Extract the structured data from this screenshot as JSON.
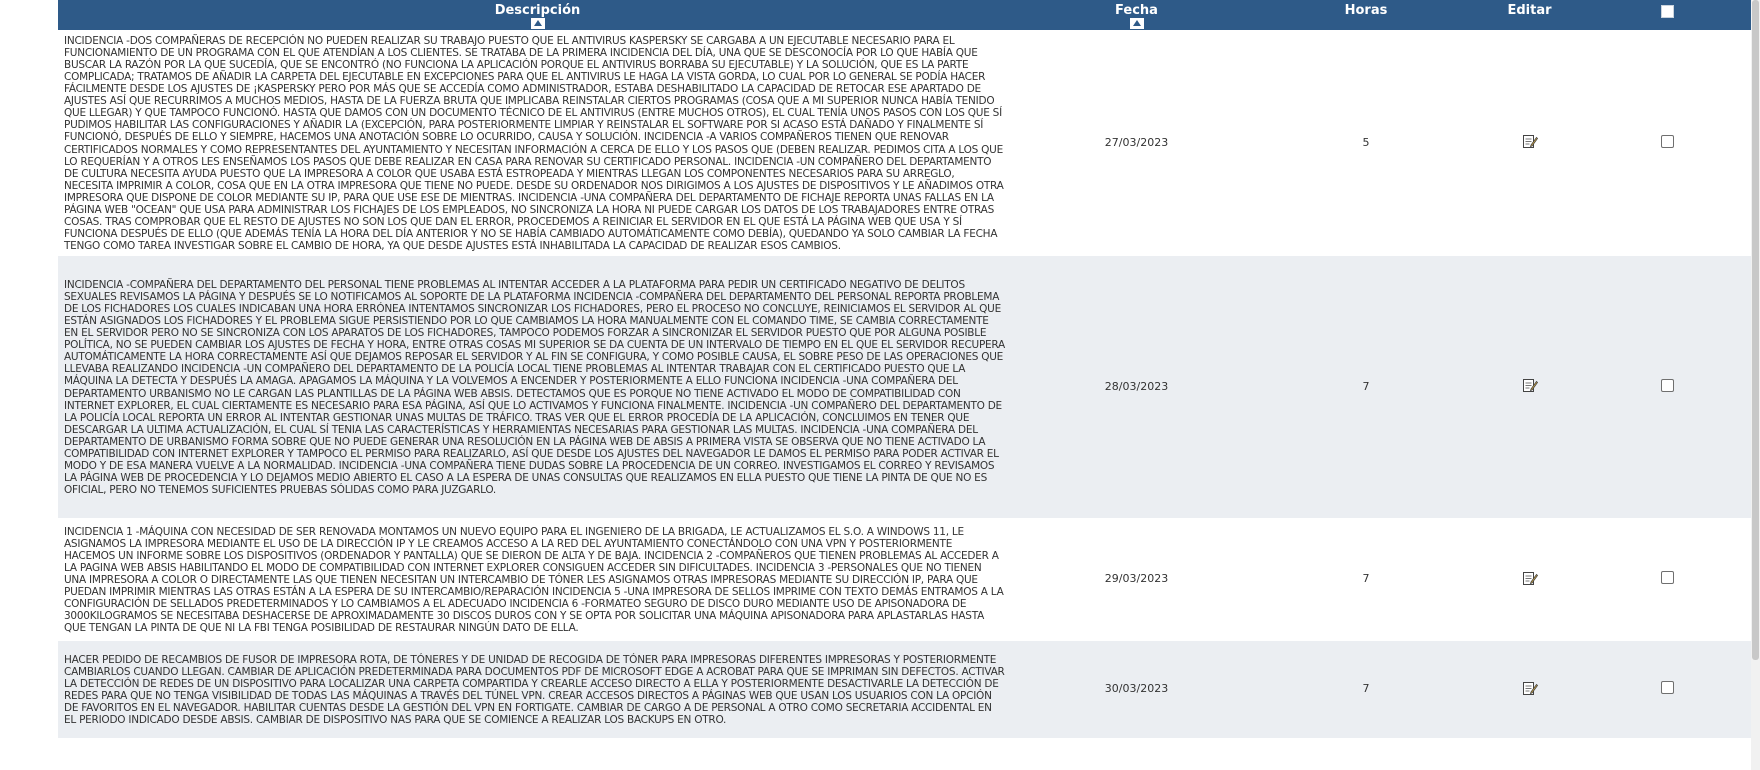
{
  "table": {
    "headers": {
      "description": "Descripción",
      "date": "Fecha",
      "hours": "Horas",
      "edit": "Editar"
    },
    "rows": [
      {
        "description": "Incidencia -Dos compañeras de recepción no pueden realizar su trabajo puesto que el antivirus Kaspersky se cargaba a un ejecutable necesario para el funcionamiento de un programa con el que atendían a los clientes. Se trataba de la primera incidencia del día, una que se desconocía por lo que había que buscar la razón por la que sucedía, que se encontró (no funciona la aplicación porque el antivirus borraba su ejecutable) y la solución, que es la parte complicada; tratamos de añadir la carpeta del ejecutable en excepciones para que el antivirus le haga la vista gorda, lo cual por lo general se podía hacer fácilmente desde los ajustes de ¡Kaspersky pero por más que se accedía como administrador, estaba deshabilitado la capacidad de retocar ese apartado de ajustes así que recurrimos a muchos medios, hasta de la fuerza bruta que implicaba reinstalar ciertos programas (cosa que a mi superior nunca había tenido que llegar) y que tampoco funcionó. Hasta que damos con un documento técnico de el antivirus (entre muchos otros), el cual tenía unos pasos con los que sí pudimos habilitar las configuraciones y añadir la (excepción, para posteriormente limpiar y reinstalar el software por si acaso está dañado y finalmente sí funcionó, después de ello y siempre, hacemos una anotación sobre lo ocurrido, causa y solución. Incidencia -A varios compañeros tienen que renovar certificados normales y como representantes del ayuntamiento y necesitan información a cerca de ello y los pasos que (deben realizar. Pedimos cita a los que lo requerían y a otros les enseñamos los pasos que debe realizar en casa para renovar su certificado personal. Incidencia -Un compañero del departamento de cultura necesita ayuda puesto que la impresora a color que usaba está estropeada y mientras llegan los componentes necesarios para su arreglo, necesita imprimir a color, cosa que en la otra impresora que tiene no puede. Desde su ordenador nos dirigimos a los ajustes de dispositivos y le añadimos otra impresora que dispone de color mediante su IP, para que use ese de mientras. Incidencia -Una compañera del departamento de fichaje reporta unas fallas en la página web \"Ocean\" que usa para administrar los fichajes de los empleados, no sincroniza la hora ni puede cargar los datos de los trabajadores entre otras cosas. Tras comprobar que el resto de ajustes no son los que dan el error, procedemos a reiniciar el servidor en el que está la página web que usa y sí funciona después de ello (que además tenía la hora del día anterior y no se había cambiado automáticamente como debía), quedando ya solo cambiar la fecha tengo como tarea investigar sobre el cambio de hora, ya que desde ajustes está inhabilitada la capacidad de realizar esos cambios.",
        "date": "27/03/2023",
        "hours": "5"
      },
      {
        "description": "Incidencia -Compañera del departamento del personal tiene problemas al intentar acceder a la plataforma para pedir un certificado negativo de delitos sexuales revisamos la página y después se lo notificamos al soporte de la plataforma Incidencia -Compañera del departamento del personal reporta problema de los fichadores los cuales indicaban una hora errónea intentamos sincronizar los fichadores, pero el proceso no concluye, reiniciamos el servidor al que están asignados los fichadores y el problema sigue persistiendo por lo que cambiamos la hora manualmente con el comando time, se cambia correctamente en el servidor pero no se sincroniza con los aparatos de los fichadores, tampoco podemos forzar a sincronizar el servidor puesto que por alguna posible política, no se pueden cambiar los ajustes de fecha y hora, entre otras cosas mi superior se da cuenta de un intervalo de tiempo en el que el servidor recupera automáticamente la hora correctamente así que dejamos reposar el servidor y al fin se configura, y como posible causa, el sobre peso de las operaciones que llevaba realizando Incidencia -Un compañero del departamento de la policía local tiene problemas al intentar trabajar con el certificado puesto que la máquina la detecta y después la amaga. Apagamos la máquina y la volvemos a encender y posteriormente a ello funciona Incidencia -Una compañera del departamento urbanismo no le cargan las plantillas de la página web Absis. Detectamos que es porque no tiene activado el modo de compatibilidad con internet explorer, el cual ciertamente es necesario para esa página, así que lo activamos y funciona finalmente. Incidencia -Un compañero del departamento de la policía local reporta un error al intentar gestionar unas multas de tráfico. Tras ver que el error procedía de la aplicación, concluimos en tener que descargar la ultima actualización, el cual sí tenia las características y herramientas necesarias para gestionar las multas. Incidencia -Una compañera del departamento de urbanismo forma sobre que no puede generar una resolución en la página web de Absis a primera vista se observa que no tiene activado la compatibilidad con internet explorer y tampoco el permiso para realizarlo, así que desde los ajustes del navegador le damos el permiso para poder activar el modo y de esa manera vuelve a la normalidad. Incidencia -Una compañera tiene dudas sobre la procedencia de un correo. Investigamos el correo y revisamos la página web de procedencia y lo dejamos medio abierto el caso a la espera de unas consultas que realizamos en ella puesto que tiene la pinta de que no es oficial, pero no tenemos suficientes pruebas sólidas como para juzgarlo.",
        "date": "28/03/2023",
        "hours": "7"
      },
      {
        "description": "Incidencia 1 -Máquina con necesidad de ser renovada montamos un nuevo equipo para el ingeniero de la brigada, le actualizamos el S.O. a Windows 11, le asignamos la impresora mediante el uso de la dirección IP y le creamos acceso a la red del ayuntamiento conectándolo con una VPN y posteriormente hacemos un informe sobre los dispositivos (ordenador y pantalla) que se dieron de alta y de baja. Incidencia 2 -Compañeros que tienen problemas al acceder a la pagina web Absis habilitando el modo de compatibilidad con internet explorer consiguen acceder sin dificultades. Incidencia 3 -Personales que no tienen una impresora a color o directamente las que tienen necesitan un intercambio de tóner les asignamos otras impresoras mediante su dirección IP, para que puedan imprimir mientras las otras están a la espera de su intercambio/reparación Incidencia 5 -Una impresora de sellos imprime con texto demás entramos a la configuración de sellados predeterminados y lo cambiamos a el adecuado Incidencia 6 -Formateo seguro de disco duro mediante uso de apisonadora de 3000kilogramos se necesitaba deshacerse de aproximadamente 30 discos duros con y se opta por solicitar una máquina apisonadora para aplastarlas hasta que tengan la pinta de que ni la FBI tenga posibilidad de restaurar ningún dato de ella.",
        "date": "29/03/2023",
        "hours": "7"
      },
      {
        "description": "Hacer pedido de recambios de fusor de impresora rota, de tóneres y de unidad de recogida de tóner para impresoras diferentes impresoras y posteriormente cambiarlos cuando llegan. Cambiar de aplicación predeterminada para documentos PDF de Microsoft Edge a Acrobat para que se impriman sin defectos. Activar la detección de redes de un dispositivo para localizar una carpeta compartida y crearle acceso directo a ella y posteriormente desactivarle la detección de redes para que no tenga visibilidad de todas las máquinas a través del túnel VPN. Crear accesos directos a páginas web que usan los usuarios con la opción de favoritos en el navegador. Habilitar cuentas desde la gestión del VPN en Fortigate. Cambiar de cargo a de personal a otro como secretaria accidental en el periodo indicado desde Absis. Cambiar de dispositivo NAS para que se comience a realizar los backups en otro.",
        "date": "30/03/2023",
        "hours": "7"
      }
    ]
  },
  "colors": {
    "header_bg": "#2e5a88",
    "row_alt_bg": "#ebeef2"
  },
  "icons": {
    "edit": "edit-note-icon",
    "sort": "sort-asc-icon"
  }
}
